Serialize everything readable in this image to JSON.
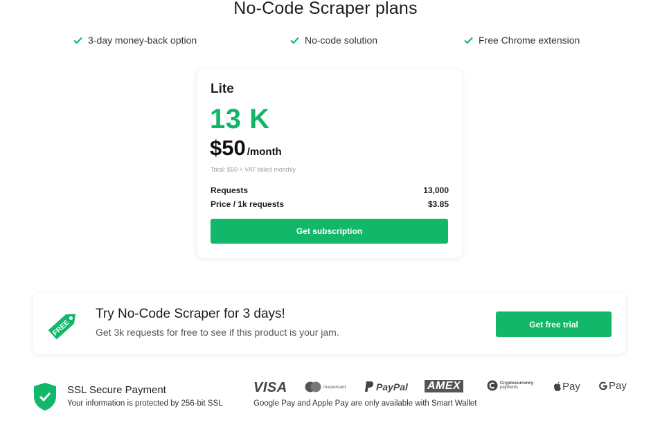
{
  "page": {
    "title": "No-Code Scraper plans"
  },
  "features": [
    {
      "label": "3-day money-back option"
    },
    {
      "label": "No-code solution"
    },
    {
      "label": "Free Chrome extension"
    }
  ],
  "plan": {
    "name": "Lite",
    "amount": "13 K",
    "price": "$50",
    "period": "/month",
    "note": "Total: $50 + VAT billed monthly",
    "rows": [
      {
        "label": "Requests",
        "value": "13,000"
      },
      {
        "label": "Price / 1k requests",
        "value": "$3.85"
      }
    ],
    "cta": "Get subscription"
  },
  "trial": {
    "tag_text": "FREE",
    "title": "Try No-Code Scraper for 3 days!",
    "subtitle": "Get 3k requests for free to see if this product is your jam.",
    "button": "Get free trial"
  },
  "ssl": {
    "title": "SSL Secure Payment",
    "subtitle": "Your information is protected by 256-bit SSL"
  },
  "payments": {
    "visa": "VISA",
    "mastercard": "mastercard",
    "paypal": "PayPal",
    "amex": "AMEX",
    "crypto_line1": "Cryptocurrency",
    "crypto_line2": "payments",
    "applepay": "Pay",
    "googlepay": "Pay",
    "note": "Google Pay and Apple Pay are only available with Smart Wallet"
  },
  "colors": {
    "accent": "#12b769",
    "amount": "#10b567",
    "text": "#1d1d1f"
  }
}
